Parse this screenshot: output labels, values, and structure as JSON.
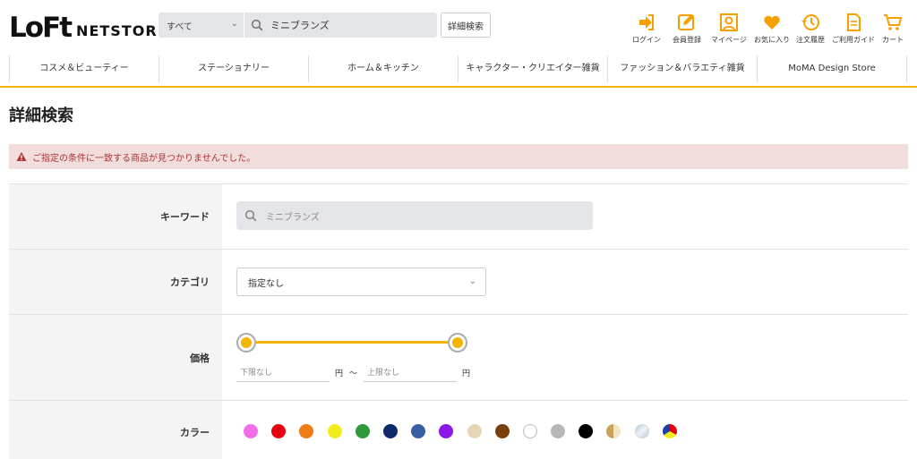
{
  "header": {
    "logo_mark": "LoFt",
    "logo_text": "NETSTORE",
    "search_scope": "すべて",
    "search_value": "ミニブランズ",
    "advanced_button": "詳細検索",
    "utility": [
      {
        "label": "ログイン",
        "icon": "login-icon"
      },
      {
        "label": "会員登録",
        "icon": "register-icon"
      },
      {
        "label": "マイページ",
        "icon": "mypage-icon"
      },
      {
        "label": "お気に入り",
        "icon": "heart-icon"
      },
      {
        "label": "注文履歴",
        "icon": "history-icon"
      },
      {
        "label": "ご利用ガイド",
        "icon": "guide-icon"
      },
      {
        "label": "カート",
        "icon": "cart-icon"
      }
    ]
  },
  "nav": {
    "categories": [
      "コスメ＆ビューティー",
      "ステーショナリー",
      "ホーム＆キッチン",
      "キャラクター・クリエイター雑貨",
      "ファッション＆バラエティ雑貨",
      "MoMA Design Store"
    ]
  },
  "page": {
    "title": "詳細検索",
    "alert": "ご指定の条件に一致する商品が見つかりませんでした。"
  },
  "form": {
    "keyword_label": "キーワード",
    "keyword_value": "ミニブランズ",
    "category_label": "カテゴリ",
    "category_value": "指定なし",
    "price_label": "価格",
    "price_min_placeholder": "下限なし",
    "price_max_placeholder": "上限なし",
    "yen": "円",
    "tilde": "〜",
    "color_label": "カラー",
    "colors": [
      "#f06ee8",
      "#e60012",
      "#f07a14",
      "#f3ec1b",
      "#2e9a3b",
      "#0f2a6b",
      "#3a5fa6",
      "#8b17e8",
      "#e5d6b8",
      "#7a3e0c",
      "#ffffff",
      "#b7b7b7",
      "#000000",
      "gold",
      "silver",
      "multi"
    ]
  },
  "colors": {
    "accent": "#f5b400",
    "alert_bg": "#f2dddd",
    "alert_text": "#a33333"
  }
}
